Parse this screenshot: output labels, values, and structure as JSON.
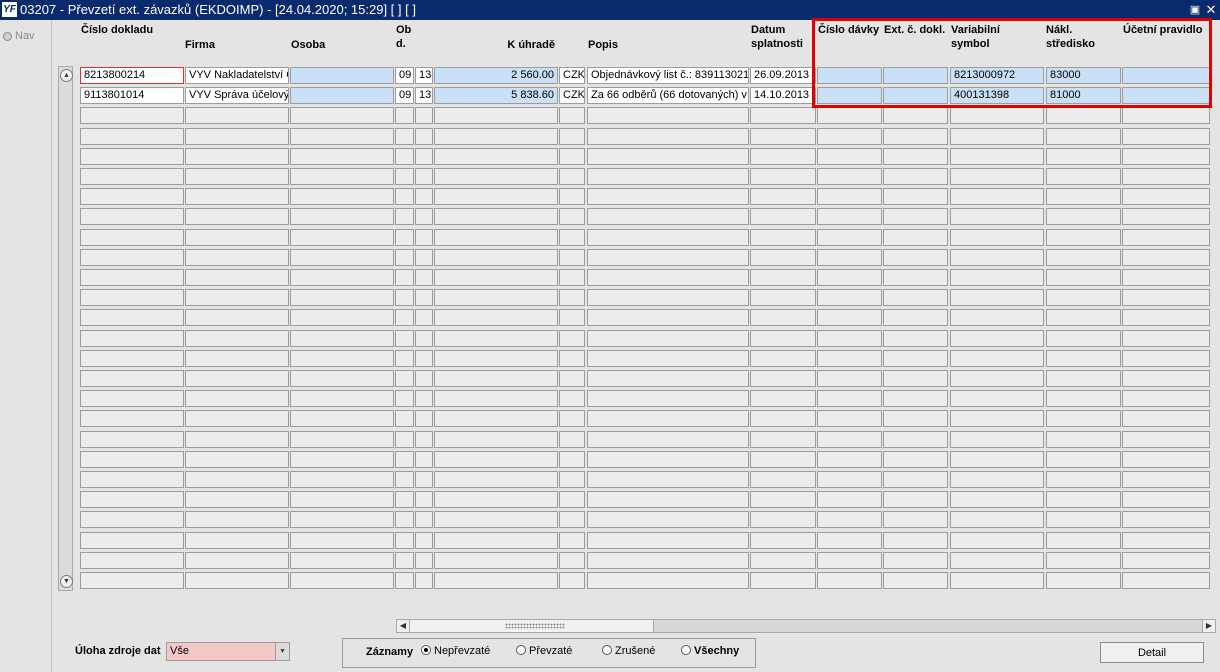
{
  "window": {
    "app_icon": "YF",
    "title": "03207 - Převzetí ext. závazků (EKDOIMP) - [24.04.2020; 15:29]  [ ]  [ ]",
    "restore_icon": "restore-icon",
    "close_icon": "close-icon"
  },
  "sidebar": {
    "nav_label": "Nav"
  },
  "table": {
    "headers": {
      "cislo_dokladu": "Číslo dokladu",
      "firma": "Firma",
      "osoba": "Osoba",
      "obd": "Ob d.",
      "k_uhrade": "K úhradě",
      "popis": "Popis",
      "datum_splatnosti": "Datum splatnosti",
      "cislo_davky": "Číslo dávky",
      "ext_c_dokl": "Ext. č. dokl.",
      "variabilni_symbol": "Variabilní symbol",
      "nakl_stredisko": "Nákl. středisko",
      "ucetni_pravidlo": "Účetní pravidlo"
    },
    "rows": [
      {
        "cislo_dokladu": "8213800214",
        "firma": "VYV Nakladatelství Č",
        "osoba": "",
        "ob1": "09",
        "ob2": "13",
        "k_uhrade": "2 560.00",
        "mena": "CZK",
        "popis": "Objednávkový list č.: 839113021",
        "datum_splatnosti": "26.09.2013",
        "cislo_davky": "",
        "ext_c_dokl": "",
        "variabilni_symbol": "8213000972",
        "nakl_stredisko": "83000",
        "ucetni_pravidlo": ""
      },
      {
        "cislo_dokladu": "9113801014",
        "firma": "VYV Správa účelový",
        "osoba": "",
        "ob1": "09",
        "ob2": "13",
        "k_uhrade": "5 838.60",
        "mena": "CZK",
        "popis": "Za 66 odběrů (66 dotovaných) v",
        "datum_splatnosti": "14.10.2013",
        "cislo_davky": "",
        "ext_c_dokl": "",
        "variabilni_symbol": "400131398",
        "nakl_stredisko": "81000",
        "ucetni_pravidlo": ""
      }
    ]
  },
  "footer": {
    "uloha_label": "Úloha zdroje dat",
    "uloha_value": "Vše",
    "zaznamy_label": "Záznamy",
    "radio_options": [
      {
        "label": "Nepřevzaté",
        "checked": true
      },
      {
        "label": "Převzaté",
        "checked": false
      },
      {
        "label": "Zrušené",
        "checked": false
      },
      {
        "label": "Všechny",
        "checked": false
      }
    ],
    "detail_label": "Detail"
  }
}
